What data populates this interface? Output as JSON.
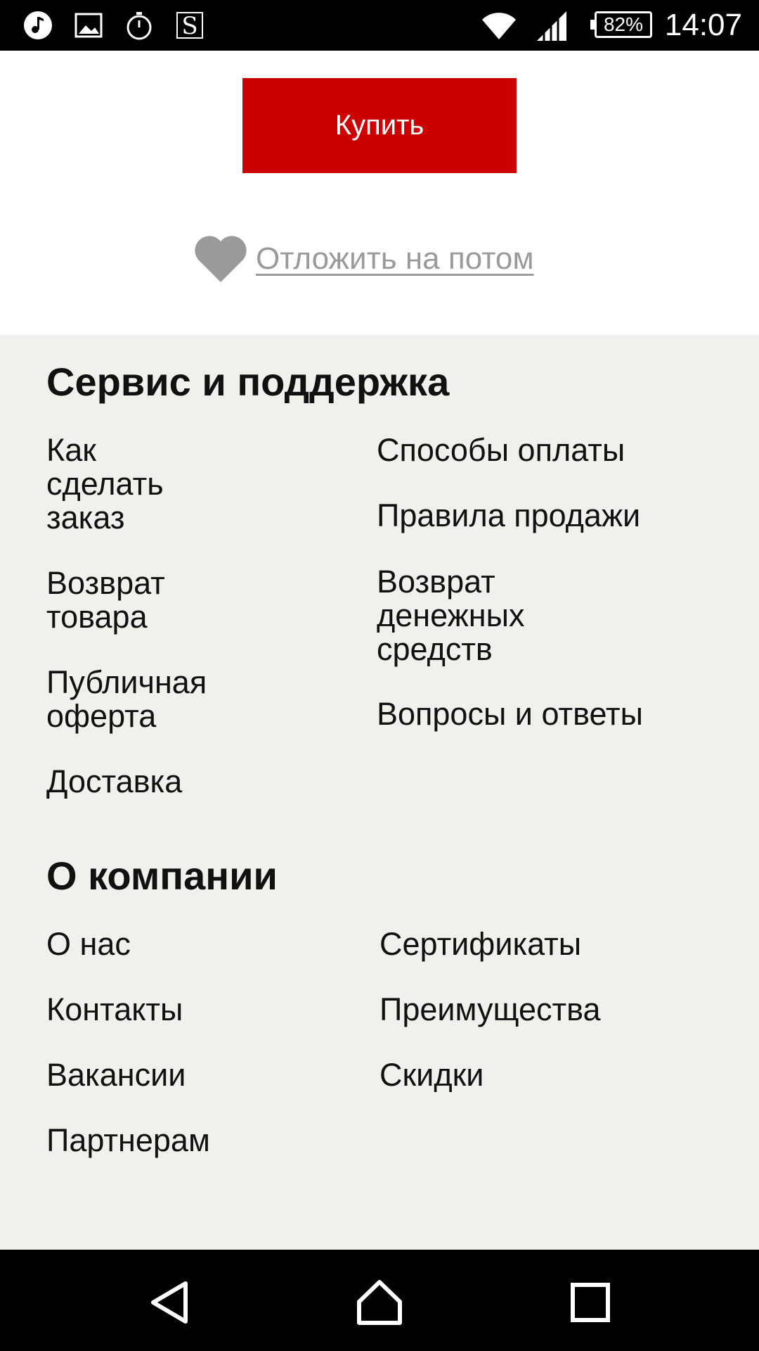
{
  "status_bar": {
    "time": "14:07",
    "battery": "82%",
    "icons": [
      "music-icon",
      "image-icon",
      "timer-icon",
      "s-app-icon",
      "wifi-icon",
      "signal-icon",
      "battery-icon"
    ]
  },
  "product_actions": {
    "buy_label": "Купить",
    "later_label": "Отложить на потом"
  },
  "service": {
    "title": "Сервис и поддержка",
    "left_links": [
      "Как сделать заказ",
      "Возврат товара",
      "Публичная оферта",
      "Доставка"
    ],
    "right_links": [
      "Способы оплаты",
      "Правила продажи",
      "Возврат денежных средств",
      "Вопросы и ответы"
    ]
  },
  "company": {
    "title": "О компании",
    "left_links": [
      "О нас",
      "Контакты",
      "Вакансии",
      "Партнерам"
    ],
    "right_links": [
      "Сертификаты",
      "Преимущества",
      "Скидки"
    ]
  },
  "nav_bar": {
    "icons": [
      "back-icon",
      "home-icon",
      "recents-icon"
    ]
  },
  "colors": {
    "accent": "#cc0000",
    "footer_bg": "#f0f0ec",
    "muted": "#9a9a9a"
  }
}
